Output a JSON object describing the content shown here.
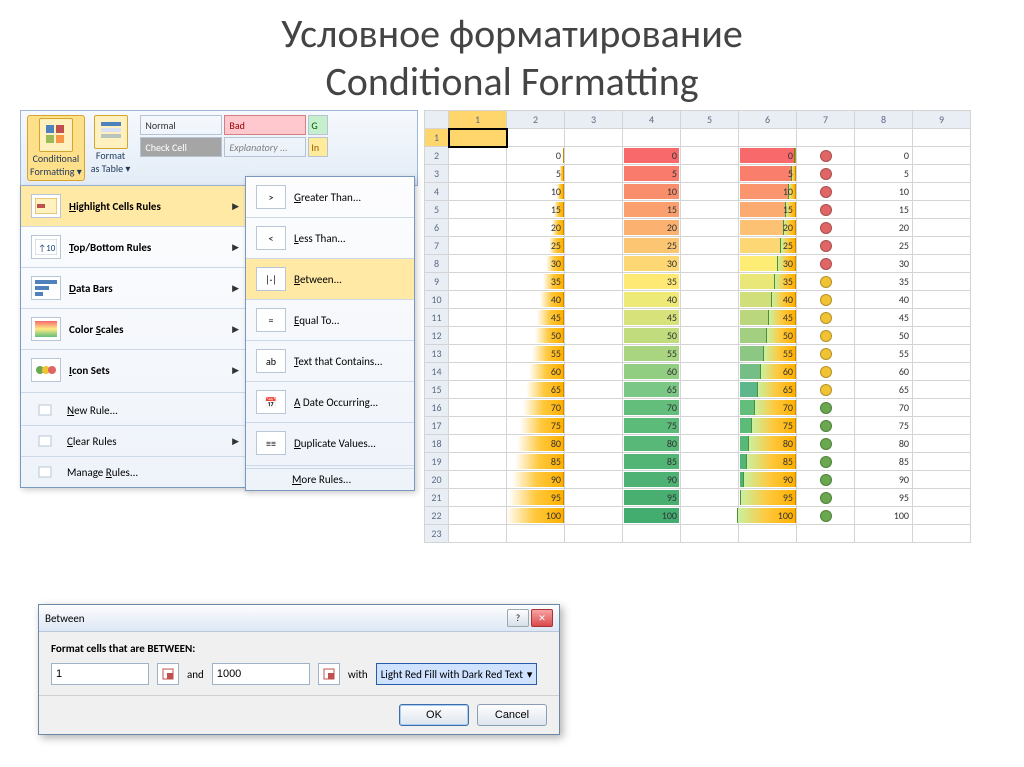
{
  "title": {
    "line1": "Условное форматирование",
    "line2": "Conditional Formatting"
  },
  "ribbon": {
    "cond_fmt": {
      "line1": "Conditional",
      "line2": "Formatting"
    },
    "fmt_table": {
      "line1": "Format",
      "line2": "as Table"
    },
    "styles": {
      "normal": "Normal",
      "bad": "Bad",
      "good_clamp": "G",
      "check": "Check Cell",
      "explanatory": "Explanatory ...",
      "input_clamp": "In"
    }
  },
  "menu": {
    "items": [
      "Highlight Cells Rules",
      "Top/Bottom Rules",
      "Data Bars",
      "Color Scales",
      "Icon Sets"
    ],
    "underline": [
      "H",
      "T",
      "D",
      "S",
      "I"
    ],
    "tail": [
      "New Rule...",
      "Clear Rules",
      "Manage Rules..."
    ],
    "tail_underline": [
      "N",
      "C",
      "R"
    ]
  },
  "submenu": {
    "items": [
      "Greater Than...",
      "Less Than...",
      "Between...",
      "Equal To...",
      "Text that Contains...",
      "A Date Occurring...",
      "Duplicate Values..."
    ],
    "underline": [
      "G",
      "L",
      "B",
      "E",
      "T",
      "A",
      "D"
    ],
    "more": "More Rules...",
    "more_underline": "M"
  },
  "dialog": {
    "title": "Between",
    "prompt": "Format cells that are BETWEEN:",
    "from": "1",
    "and": "and",
    "to": "1000",
    "with": "with",
    "option": "Light Red Fill with Dark Red Text",
    "ok": "OK",
    "cancel": "Cancel"
  },
  "sheet": {
    "cols": [
      "1",
      "2",
      "3",
      "4",
      "5",
      "6",
      "7",
      "8",
      "9"
    ],
    "values": [
      0,
      5,
      10,
      15,
      20,
      25,
      30,
      35,
      40,
      45,
      50,
      55,
      60,
      65,
      70,
      75,
      80,
      85,
      90,
      95,
      100
    ],
    "icon_colors": [
      "#e06666",
      "#e06666",
      "#e06666",
      "#e06666",
      "#e06666",
      "#e06666",
      "#e06666",
      "#f1c232",
      "#f1c232",
      "#f1c232",
      "#f1c232",
      "#f1c232",
      "#f1c232",
      "#f1c232",
      "#6aa84f",
      "#6aa84f",
      "#6aa84f",
      "#6aa84f",
      "#6aa84f",
      "#6aa84f",
      "#6aa84f"
    ],
    "colorscale": [
      "#f8696b",
      "#f87b6c",
      "#f98e6d",
      "#faa06f",
      "#fbb270",
      "#fcc572",
      "#fdd773",
      "#fee975",
      "#eeea77",
      "#d7e37a",
      "#c0dc7d",
      "#a9d580",
      "#92ce82",
      "#7bc785",
      "#63be7b",
      "#5cbb79",
      "#57b877",
      "#52b575",
      "#4db273",
      "#48af71",
      "#43ac6f"
    ],
    "colorscale6": [
      "#f8696b",
      "#f97f6c",
      "#fa956e",
      "#fbab70",
      "#fcc172",
      "#fdd773",
      "#feed75",
      "#e8e778",
      "#d1df7b",
      "#bad77e",
      "#a3cf81",
      "#8cc784",
      "#75bf87",
      "#5eb78a",
      "#63be7b",
      "#5cbb79",
      "#57b877",
      "#52b575",
      "#4db273",
      "#ffb000",
      "#ffb000"
    ]
  }
}
